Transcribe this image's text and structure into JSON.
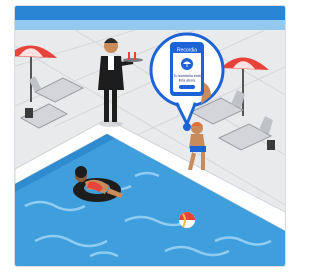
{
  "illustration": {
    "subject": "hotel-pool-scene",
    "phone": {
      "title": "Recordia",
      "caption_line1": "Tu sombrilla está",
      "caption_line2": "lista ahora"
    },
    "colors": {
      "deck": "#e9eaec",
      "pool_water": "#3f9fdc",
      "pool_deep": "#1f78c2",
      "accent_red": "#e8433a",
      "brand_blue": "#1d63d6",
      "top_wall": "#2a86d4"
    }
  }
}
